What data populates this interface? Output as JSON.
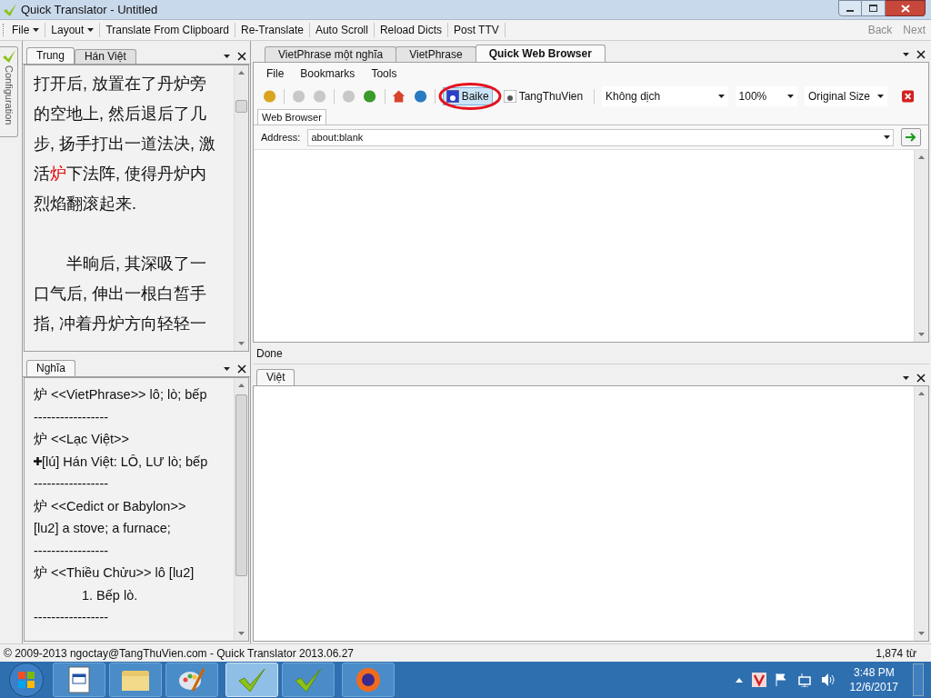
{
  "window": {
    "title": "Quick Translator - Untitled"
  },
  "menu_toolbar": [
    {
      "label": "File",
      "dropdown": true
    },
    {
      "label": "Layout",
      "dropdown": true
    },
    {
      "label": "Translate From Clipboard",
      "dropdown": false
    },
    {
      "label": "Re-Translate",
      "dropdown": false
    },
    {
      "label": "Auto Scroll",
      "dropdown": false
    },
    {
      "label": "Reload Dicts",
      "dropdown": false
    },
    {
      "label": "Post TTV",
      "dropdown": false
    }
  ],
  "nav": [
    {
      "label": "Back",
      "disabled": true
    },
    {
      "label": "Next",
      "disabled": true
    }
  ],
  "side_tab": {
    "label": "Configuration"
  },
  "source_pane": {
    "tabs": [
      {
        "label": "Trung",
        "selected": true
      },
      {
        "label": "Hán Việt",
        "selected": false
      }
    ],
    "paragraphs": [
      [
        [
          {
            "text": "打开后, 放置在了丹炉旁",
            "highlighted": false
          }
        ],
        [
          {
            "text": "的空地上, 然后退后了几",
            "highlighted": false
          }
        ],
        [
          {
            "text": "步, 扬手打出一道法决, 激",
            "highlighted": false
          }
        ],
        [
          {
            "text": "活",
            "highlighted": false
          },
          {
            "text": "炉",
            "highlighted": true
          },
          {
            "text": "下法阵, 使得丹炉内",
            "highlighted": false
          }
        ],
        [
          {
            "text": "烈焰翻滚起来.",
            "highlighted": false
          }
        ]
      ],
      [
        [
          {
            "text": "　　半晌后, 其深吸了一",
            "highlighted": false
          }
        ],
        [
          {
            "text": "口气后, 伸出一根白皙手",
            "highlighted": false
          }
        ],
        [
          {
            "text": "指, 冲着丹炉方向轻轻一",
            "highlighted": false
          }
        ]
      ]
    ]
  },
  "meaning_pane": {
    "tabs": [
      {
        "label": "Nghĩa",
        "selected": true
      }
    ],
    "lines": [
      {
        "kind": "text",
        "text": "炉 <<VietPhrase>> lô; lò; bếp"
      },
      {
        "kind": "text",
        "text": "-----------------"
      },
      {
        "kind": "text",
        "text": "炉 <<Lạc Việt>>"
      },
      {
        "kind": "plus",
        "text": "[lú] Hán Việt: LÔ, LƯ lò; bếp"
      },
      {
        "kind": "text",
        "text": "-----------------"
      },
      {
        "kind": "text",
        "text": "炉 <<Cedict or Babylon>>"
      },
      {
        "kind": "text",
        "text": "[lu2] a stove; a furnace;"
      },
      {
        "kind": "text",
        "text": "-----------------"
      },
      {
        "kind": "text",
        "text": "炉 <<Thiều Chửu>> lô [lu2]"
      },
      {
        "kind": "indent",
        "text": "1. Bếp lò."
      },
      {
        "kind": "text",
        "text": "-----------------"
      }
    ]
  },
  "browser_pane": {
    "tabs": [
      {
        "label": "VietPhrase một nghĩa",
        "selected": false
      },
      {
        "label": "VietPhrase",
        "selected": false
      },
      {
        "label": "Quick Web Browser",
        "selected": true
      }
    ],
    "menu": [
      "File",
      "Bookmarks",
      "Tools"
    ],
    "bookmarks": [
      {
        "label": "Baike",
        "selected": true,
        "circled": true
      },
      {
        "label": "TangThuVien",
        "selected": false,
        "circled": false
      }
    ],
    "dropdowns": [
      "Không dịch",
      "100%",
      "Original Size"
    ],
    "inner_tab": {
      "label": "Web Browser"
    },
    "address": {
      "label": "Address:",
      "value": "about:blank"
    },
    "status": "Done"
  },
  "target_pane": {
    "tabs": [
      {
        "label": "Việt",
        "selected": true
      }
    ]
  },
  "status_bar": {
    "left": "© 2009-2013 ngoctay@TangThuVien.com - Quick Translator 2013.06.27",
    "right": "1,874 từ"
  },
  "taskbar": {
    "time": "3:48 PM",
    "date": "12/6/2017",
    "apps": [
      {
        "kind": "document",
        "active": false
      },
      {
        "kind": "folder",
        "active": false
      },
      {
        "kind": "paint",
        "active": false
      },
      {
        "kind": "check",
        "active": true
      },
      {
        "kind": "check",
        "active": false
      },
      {
        "kind": "browser",
        "active": false
      }
    ]
  }
}
